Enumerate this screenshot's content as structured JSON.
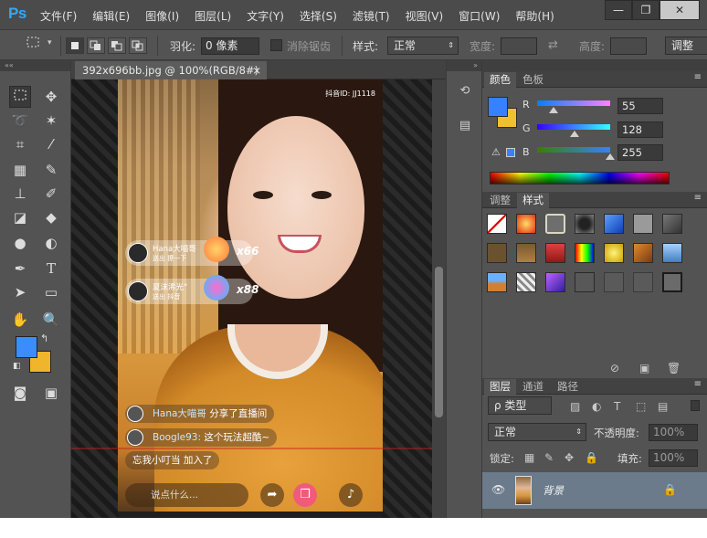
{
  "app": {
    "logo": "Ps",
    "menu": [
      "文件(F)",
      "编辑(E)",
      "图像(I)",
      "图层(L)",
      "文字(Y)",
      "选择(S)",
      "滤镜(T)",
      "视图(V)",
      "窗口(W)",
      "帮助(H)"
    ],
    "window_controls": {
      "minimize": "—",
      "restore": "❐",
      "close": "✕"
    }
  },
  "options": {
    "feather_label": "羽化:",
    "feather_value": "0 像素",
    "antialias_label": "消除锯齿",
    "style_label": "样式:",
    "style_value": "正常",
    "width_label": "宽度:",
    "height_label": "高度:",
    "refine_label": "调整"
  },
  "document": {
    "tab_title": "392x696bb.jpg @ 100%(RGB/8#)",
    "tab_close": "×",
    "tiktok_id": "抖音ID: JJ1118",
    "gifts": [
      {
        "name": "Hana大喵哥",
        "sub": "送出 撩一下",
        "count": "x66"
      },
      {
        "name": "夏沫浠光°",
        "sub": "送出 抖音",
        "count": "x88"
      }
    ],
    "chats": [
      {
        "who": "Hana大喵哥",
        "text": " 分享了直播间"
      },
      {
        "who": "Boogle93:",
        "text": " 这个玩法超酷~"
      },
      {
        "who": "",
        "text": "忘我小叮当 加入了"
      }
    ],
    "say_placeholder": "说点什么..."
  },
  "color_panel": {
    "tabs": [
      "颜色",
      "色板"
    ],
    "r_label": "R",
    "r_value": "55",
    "g_label": "G",
    "g_value": "128",
    "b_label": "B",
    "b_value": "255",
    "fg_color": "#3780ff",
    "bg_color": "#f0c030"
  },
  "styles_panel": {
    "tabs": [
      "调整",
      "样式"
    ]
  },
  "layers_panel": {
    "tabs": [
      "图层",
      "通道",
      "路径"
    ],
    "filter_label": "ρ 类型",
    "blend_mode": "正常",
    "opacity_label": "不透明度:",
    "opacity_value": "100%",
    "lock_label": "锁定:",
    "fill_label": "填充:",
    "fill_value": "100%",
    "layer_name": "背景"
  },
  "toolbar": {
    "fg_color": "#3b8cff",
    "bg_color": "#f0b52a"
  }
}
